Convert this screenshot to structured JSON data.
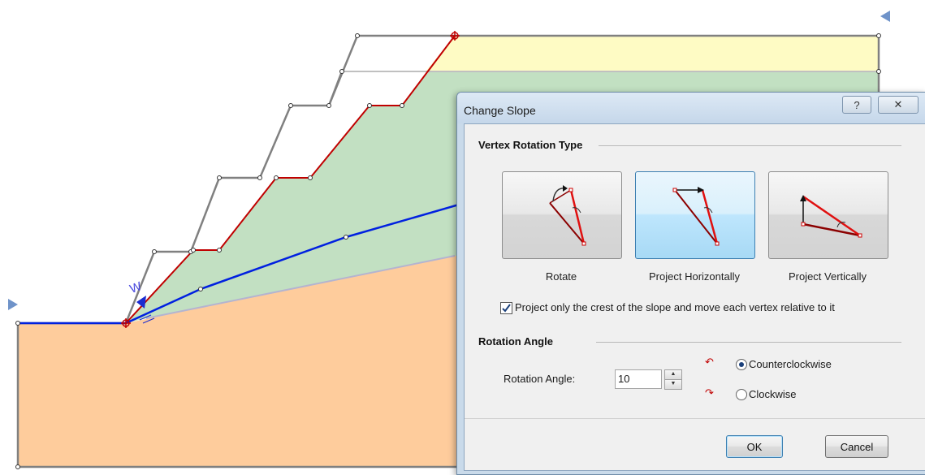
{
  "dialog": {
    "title": "Change Slope",
    "help_glyph": "?",
    "close_glyph": "✕",
    "vertex_section_title": "Vertex Rotation Type",
    "rotation_options": [
      {
        "label": "Rotate",
        "icon": "rotate-icon",
        "selected": false
      },
      {
        "label": "Project Horizontally",
        "icon": "project-horizontally-icon",
        "selected": true
      },
      {
        "label": "Project Vertically",
        "icon": "project-vertically-icon",
        "selected": false
      }
    ],
    "crest_checkbox": {
      "label": "Project only the crest of the slope and move each vertex relative to it",
      "checked": true
    },
    "angle_section_title": "Rotation Angle",
    "angle_field_label": "Rotation Angle:",
    "angle_value": "10",
    "direction_options": [
      {
        "label": "Counterclockwise",
        "selected": true
      },
      {
        "label": "Clockwise",
        "selected": false
      }
    ],
    "ok_label": "OK",
    "cancel_label": "Cancel"
  },
  "canvas": {
    "water_label": "W",
    "colors": {
      "upper_layer": "#fefbc4",
      "middle_layer": "#c2e0c2",
      "lower_layer": "#fecc9c",
      "slope_line": "#c00000",
      "water_table": "#0020e0",
      "old_boundary": "#808080"
    }
  }
}
